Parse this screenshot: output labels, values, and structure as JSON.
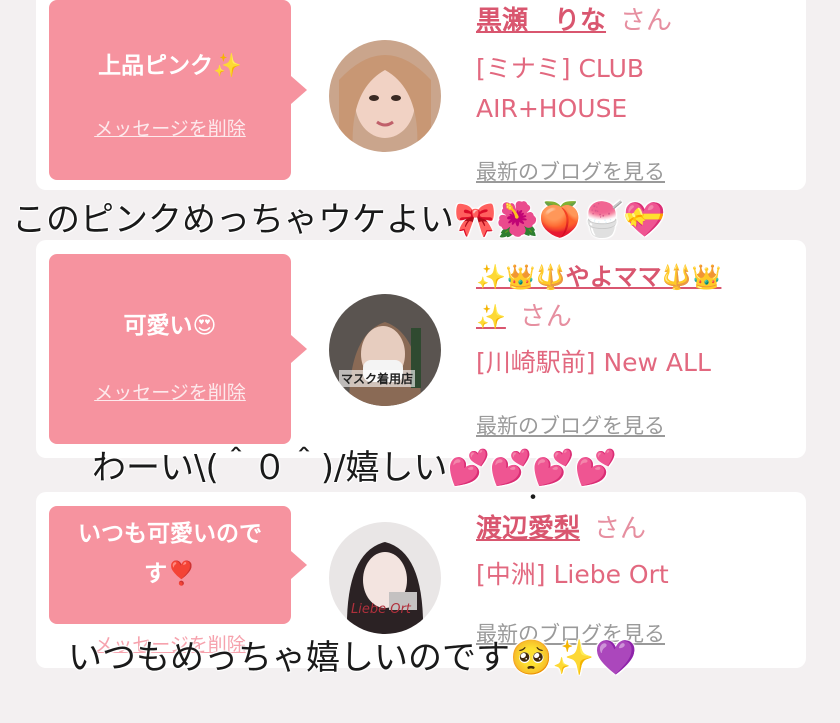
{
  "cards": [
    {
      "message": "上品ピンク✨",
      "delete_label": "メッセージを削除",
      "name": "黒瀬　りな",
      "honorific": "さん",
      "shop_line1": "[ミナミ] CLUB",
      "shop_line2": "AIR+HOUSE",
      "blog_label": "最新のブログを見る"
    },
    {
      "message": "可愛い😍",
      "delete_label": "メッセージを削除",
      "name_line1": "✨👑🔱やよママ🔱👑",
      "name_line2": "✨",
      "honorific": "さん",
      "shop_line1": "[川崎駅前] New ALL",
      "blog_label": "最新のブログを見る",
      "avatar_caption": "マスク着用店"
    },
    {
      "message_line1": "いつも可愛いので",
      "message_line2": "す❣️",
      "delete_label": "メッセージを削除",
      "name": "渡辺愛梨",
      "honorific": "さん",
      "shop_line1": "[中洲] Liebe Ort",
      "blog_label": "最新のブログを見る",
      "avatar_caption": "Liebe Ort"
    }
  ],
  "overlays": {
    "text1": "このピンクめっちゃウケよい🎀🌺🍑🍧💝",
    "text2": "わーい\\(＾０＾)/嬉しい💕💕💕💕",
    "dot": "・",
    "text3": "いつもめっちゃ嬉しいのです🥺✨💜"
  },
  "colors": {
    "bubble": "#f6939f",
    "name": "#d9566f",
    "shop": "#e2687f",
    "background": "#f3f0f1"
  }
}
